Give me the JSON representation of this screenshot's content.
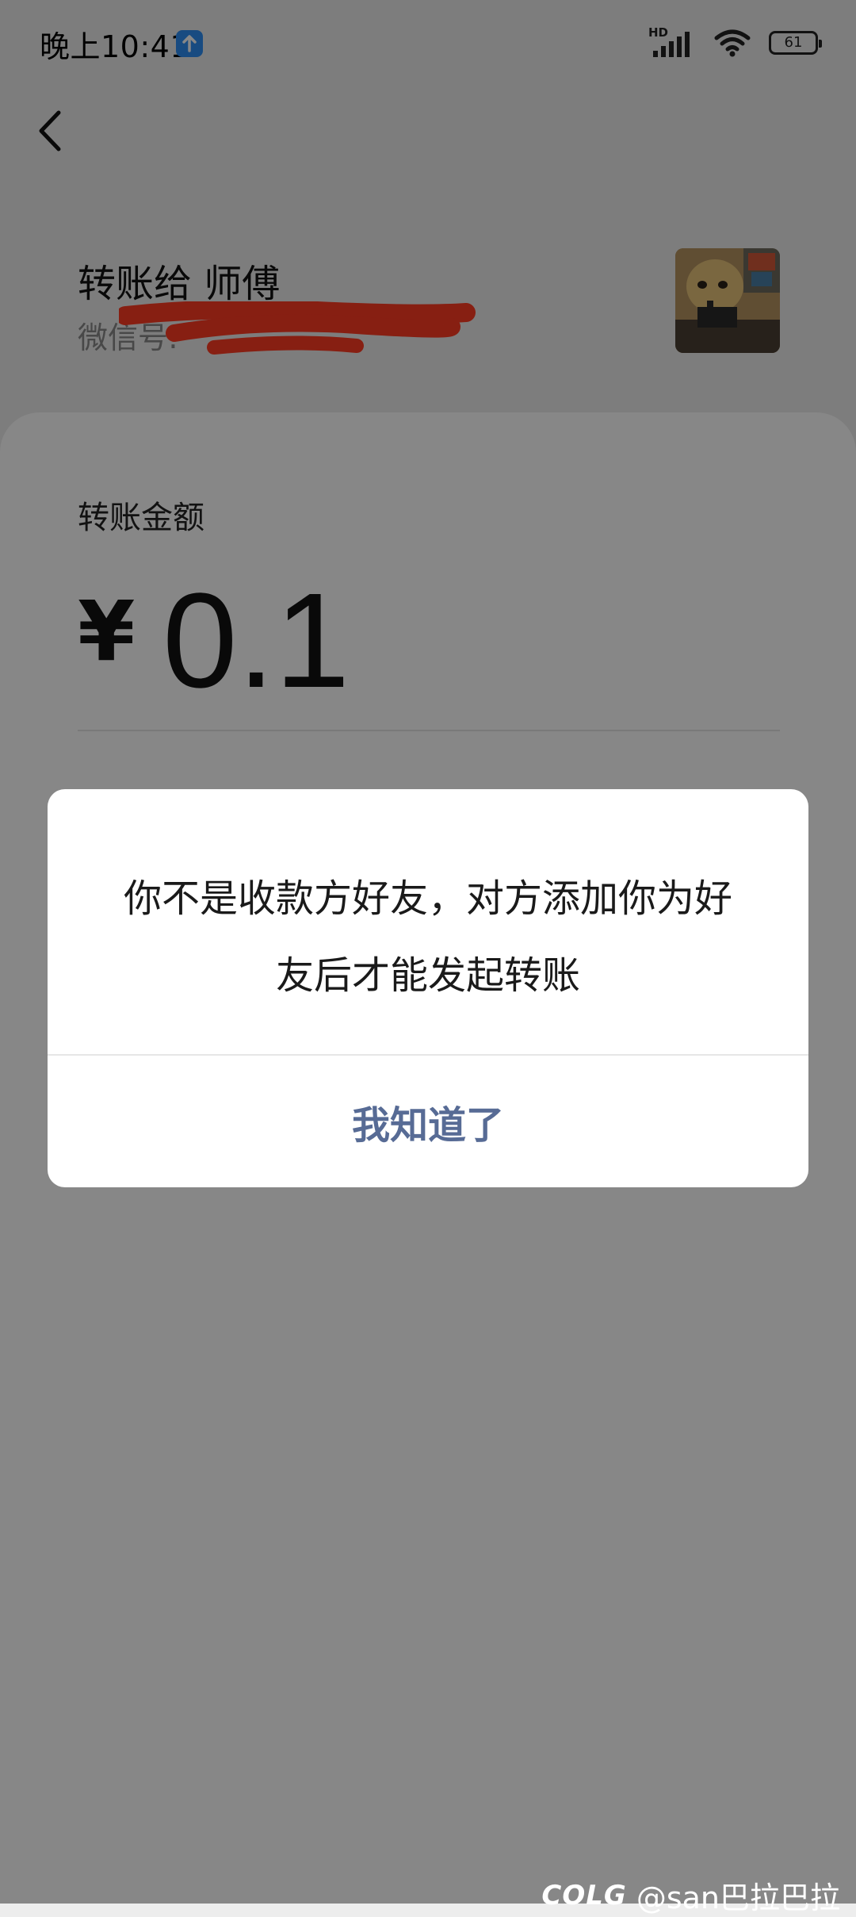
{
  "status_bar": {
    "time": "晚上10:41",
    "network_type": "HD",
    "battery_level": "61",
    "icons": [
      "upload-notification-icon",
      "signal-icon",
      "wifi-icon",
      "battery-icon"
    ]
  },
  "header": {
    "back_icon": "chevron-left-icon",
    "payee_title": "转账给 师傅",
    "wechat_id_label": "微信号:"
  },
  "transfer": {
    "amount_label": "转账金额",
    "currency_symbol": "¥",
    "amount": "0.1"
  },
  "dialog": {
    "message_line1": "你不是收款方好友，对方添加你为好",
    "message_line2": "友后才能发起转账",
    "confirm_label": "我知道了"
  },
  "watermark": {
    "logo": "COLG",
    "user": "@san巴拉巴拉"
  },
  "colors": {
    "page_background": "#ededed",
    "card_background": "#ffffff",
    "overlay": "rgba(0,0,0,0.47)",
    "dialog_button_text": "#576b95",
    "redaction_mark": "#ff3b22",
    "upload_badge": "#2f8ff3"
  }
}
